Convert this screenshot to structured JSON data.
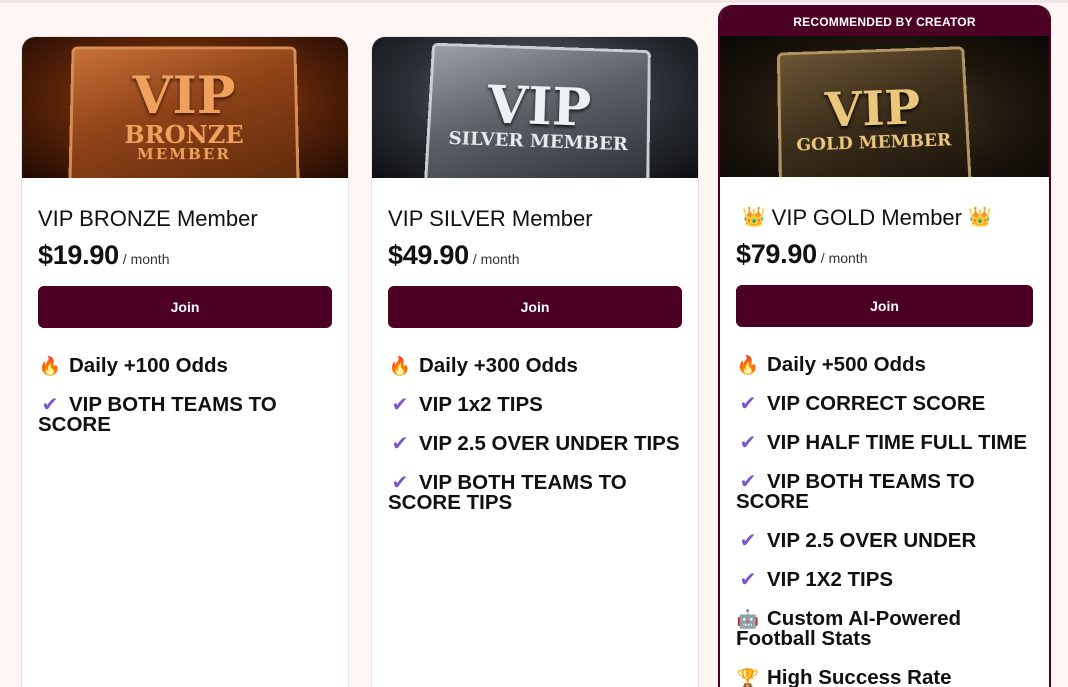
{
  "cards": [
    {
      "banner_title": "VIP",
      "banner_sub": "BRONZE",
      "banner_sub2": "MEMBER",
      "title": "VIP BRONZE Member",
      "price": "$19.90",
      "period": "/ month",
      "join_label": "Join",
      "features": [
        {
          "icon": "fire-icon",
          "glyph": "🔥",
          "text": "Daily +100 Odds"
        },
        {
          "icon": "check-icon",
          "glyph": "✔",
          "text": "VIP BOTH TEAMS TO SCORE"
        }
      ]
    },
    {
      "banner_title": "VIP",
      "banner_sub": "SILVER MEMBER",
      "title": "VIP SILVER Member",
      "price": "$49.90",
      "period": "/ month",
      "join_label": "Join",
      "features": [
        {
          "icon": "fire-icon",
          "glyph": "🔥",
          "text": "Daily +300 Odds"
        },
        {
          "icon": "check-icon",
          "glyph": "✔",
          "text": "VIP 1x2 TIPS"
        },
        {
          "icon": "check-icon",
          "glyph": "✔",
          "text": "VIP 2.5 OVER UNDER TIPS"
        },
        {
          "icon": "check-icon",
          "glyph": "✔",
          "text": "VIP BOTH TEAMS TO SCORE TIPS"
        }
      ]
    },
    {
      "recommended": "RECOMMENDED BY CREATOR",
      "banner_title": "VIP",
      "banner_sub": "GOLD MEMBER",
      "crown": "👑",
      "title": "VIP GOLD Member",
      "price": "$79.90",
      "period": "/ month",
      "join_label": "Join",
      "features": [
        {
          "icon": "fire-icon",
          "glyph": "🔥",
          "text": "Daily +500 Odds"
        },
        {
          "icon": "check-icon",
          "glyph": "✔",
          "text": "VIP CORRECT SCORE"
        },
        {
          "icon": "check-icon",
          "glyph": "✔",
          "text": "VIP HALF TIME FULL TIME"
        },
        {
          "icon": "check-icon",
          "glyph": "✔",
          "text": "VIP BOTH TEAMS TO SCORE"
        },
        {
          "icon": "check-icon",
          "glyph": "✔",
          "text": "VIP 2.5 OVER UNDER"
        },
        {
          "icon": "check-icon",
          "glyph": "✔",
          "text": "VIP 1X2 TIPS"
        },
        {
          "icon": "robot-icon",
          "glyph": "🤖",
          "text": "Custom AI-Powered Football Stats"
        },
        {
          "icon": "trophy-icon",
          "glyph": "🏆",
          "text": "High Success Rate"
        }
      ]
    }
  ],
  "colors": {
    "accent": "#4c0124",
    "check": "#7b58c9",
    "background": "#fdf6f5"
  }
}
